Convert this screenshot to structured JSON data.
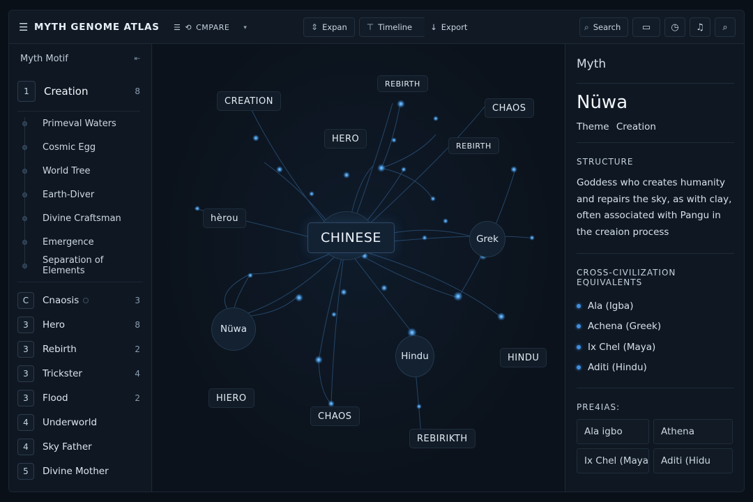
{
  "app": {
    "title": "MYTH GENOME ATLAS",
    "compare_label": "CMPARE"
  },
  "toolbar": {
    "expand": "Expan",
    "timeline": "Timeline",
    "export": "Export",
    "search": "Search"
  },
  "sidebar": {
    "header": "Myth Motif",
    "active": {
      "num": "1",
      "label": "Creation",
      "count": "8"
    },
    "sub_items": [
      "Primeval Waters",
      "Cosmic Egg",
      "World Tree",
      "Earth-Diver",
      "Divine Craftsman",
      "Emergence",
      "Separation of Elements"
    ],
    "motifs": [
      {
        "num": "C",
        "label": "Cnaosis",
        "count": "3"
      },
      {
        "num": "3",
        "label": "Hero",
        "count": "8"
      },
      {
        "num": "3",
        "label": "Rebirth",
        "count": "2"
      },
      {
        "num": "3",
        "label": "Trickster",
        "count": "4"
      },
      {
        "num": "3",
        "label": "Flood",
        "count": "2"
      },
      {
        "num": "4",
        "label": "Underworld",
        "count": ""
      },
      {
        "num": "4",
        "label": "Sky Father",
        "count": ""
      },
      {
        "num": "5",
        "label": "Divine Mother",
        "count": ""
      }
    ]
  },
  "graph": {
    "labels": {
      "creation": "CREATION",
      "rebirth_top": "REBIRTH",
      "chaos_top": "CHAOS",
      "hero_top": "HERO",
      "rebirth_mid": "REBIRTH",
      "herou": "hèrou",
      "center": "CHINESE",
      "greek": "Grek",
      "nuwa": "Nüwa",
      "hindu_circle": "Hindu",
      "hindu_box": "HINDU",
      "hiero": "HIERO",
      "chaos_bottom": "CHAOS",
      "rebirth_bottom": "REBIRIKTH"
    }
  },
  "panel": {
    "title": "Myth",
    "name": "Nüwa",
    "theme_label": "Theme",
    "theme_value": "Creation",
    "structure_heading": "STRUCTURE",
    "description": "Goddess who creates humanity and repairs the sky, as with clay, often associated with Pangu in the creaion process",
    "equivalents_heading": "CROSS-CIVILIZATION EQUIVALENTS",
    "equivalents": [
      "Ala (Igba)",
      "Achena (Greek)",
      "Ix Chel (Maya)",
      "Aditi (Hindu)"
    ],
    "preaias_heading": "PRE4IAS:",
    "chips": [
      "Ala igbo",
      "Athena",
      "Ix Chel (Maya)",
      "Aditi (Hidu"
    ]
  },
  "colors": {
    "accent": "#3f8fe0",
    "background": "#0a1018",
    "panel": "#0f1722"
  }
}
